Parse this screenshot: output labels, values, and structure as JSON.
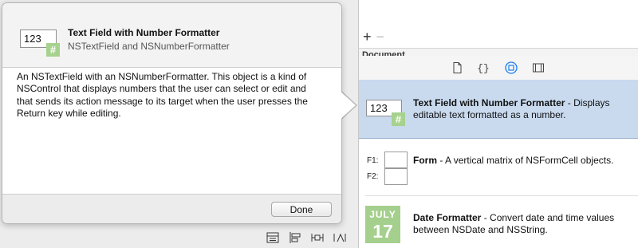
{
  "popover": {
    "preview_value": "123",
    "badge": "#",
    "title": "Text Field with Number Formatter",
    "subtitle": "NSTextField and NSNumberFormatter",
    "description": "An NSTextField with an NSNumberFormatter. This object is a kind of NSControl that displays numbers that the user can select or edit and that sends its action message to its target when the user presses the Return key while editing.",
    "done_label": "Done"
  },
  "panel": {
    "add_label": "+",
    "remove_label": "−",
    "section_label": "Document",
    "toolbar_icons": [
      "file-template-icon",
      "code-snippet-icon",
      "object-library-icon",
      "media-library-icon"
    ],
    "active_tool": "object-library-icon"
  },
  "library": {
    "items": [
      {
        "preview_value": "123",
        "badge": "#",
        "name": "Text Field with Number Formatter",
        "sep": " - ",
        "desc": "Displays editable text formatted as a number.",
        "selected": true
      },
      {
        "label_f1": "F1:",
        "label_f2": "F2:",
        "name": "Form",
        "sep": " - ",
        "desc": "A vertical matrix of NSFormCell objects."
      },
      {
        "icon_month": "JULY",
        "icon_day": "17",
        "name": "Date Formatter",
        "sep": " - ",
        "desc": "Convert date and time values between NSDate and NSString."
      }
    ]
  },
  "canvas_controls": [
    "embed-in-stack-icon",
    "align-icon",
    "pin-icon",
    "resolve-issues-icon"
  ],
  "colors": {
    "selected_row": "#c9daef",
    "badge_green": "#a6d28e",
    "accent_blue": "#1a7ff0"
  }
}
